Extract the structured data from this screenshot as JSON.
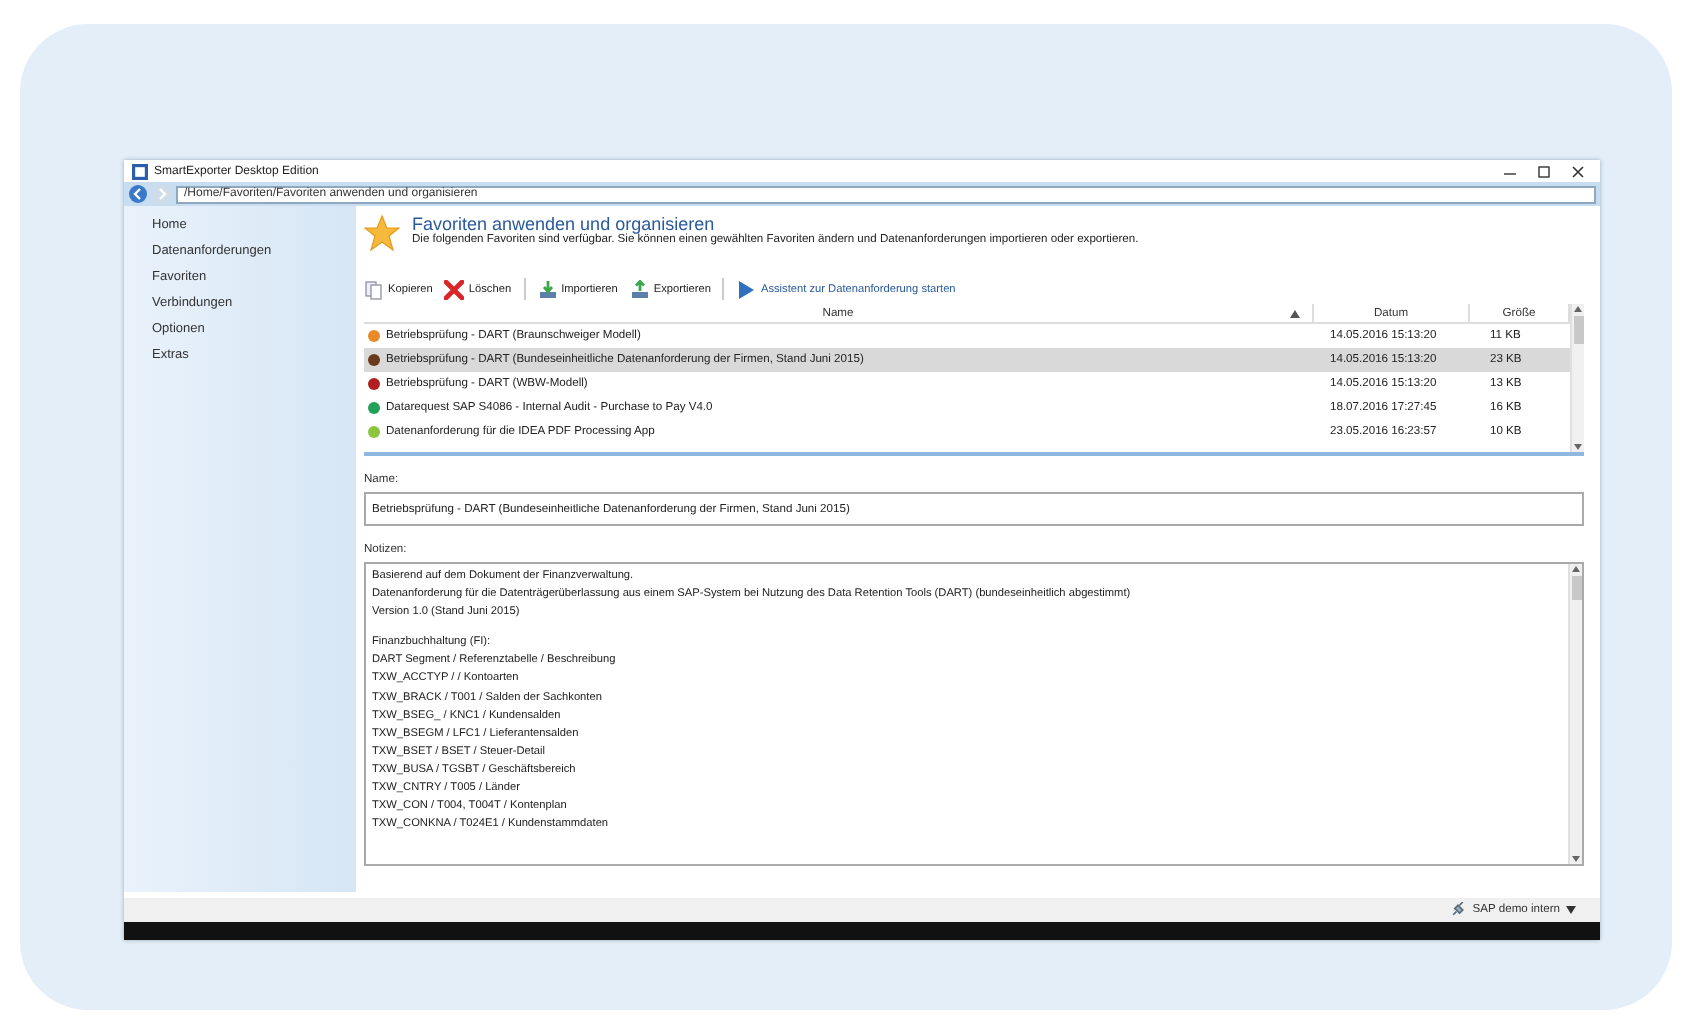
{
  "window": {
    "title": "SmartExporter Desktop Edition"
  },
  "address": {
    "path": "/Home/Favoriten/Favoriten anwenden und organisieren"
  },
  "sidebar": {
    "items": [
      {
        "label": "Home"
      },
      {
        "label": "Datenanforderungen"
      },
      {
        "label": "Favoriten"
      },
      {
        "label": "Verbindungen"
      },
      {
        "label": "Optionen"
      },
      {
        "label": "Extras"
      }
    ]
  },
  "header": {
    "title": "Favoriten anwenden und organisieren",
    "subtitle": "Die folgenden Favoriten sind verfügbar. Sie können einen gewählten Favoriten ändern und Datenanforderungen importieren oder exportieren."
  },
  "toolbar": {
    "buttons": [
      {
        "label": "Kopieren",
        "kind": "copy"
      },
      {
        "label": "Löschen",
        "kind": "delete"
      },
      {
        "label": "Importieren",
        "kind": "import"
      },
      {
        "label": "Exportieren",
        "kind": "export"
      },
      {
        "label": "Assistent zur Datenanforderung starten",
        "kind": "wizard"
      }
    ]
  },
  "table": {
    "columns": [
      "Name",
      "Datum",
      "Größe"
    ],
    "rows": [
      {
        "name": "Betriebsprüfung - DART (Braunschweiger Modell)",
        "date": "14.05.2016 15:13:20",
        "size": "11 KB",
        "color": "#e8892a",
        "selected": false
      },
      {
        "name": "Betriebsprüfung - DART (Bundeseinheitliche Datenanforderung der Firmen, Stand Juni 2015)",
        "date": "14.05.2016 15:13:20",
        "size": "23 KB",
        "color": "#6b3a1c",
        "selected": true
      },
      {
        "name": "Betriebsprüfung - DART (WBW-Modell)",
        "date": "14.05.2016 15:13:20",
        "size": "13 KB",
        "color": "#b0201e",
        "selected": false
      },
      {
        "name": "Datarequest SAP S4086 - Internal Audit - Purchase to Pay V4.0",
        "date": "18.07.2016 17:27:45",
        "size": "16 KB",
        "color": "#23a05a",
        "selected": false
      },
      {
        "name": "Datenanforderung für die IDEA PDF Processing App",
        "date": "23.05.2016 16:23:57",
        "size": "10 KB",
        "color": "#8cc63f",
        "selected": false
      }
    ]
  },
  "details": {
    "name_label": "Name:",
    "name_value": "Betriebsprüfung - DART (Bundeseinheitliche Datenanforderung der Firmen, Stand Juni 2015)",
    "notes_label": "Notizen:",
    "notes": [
      "Basierend auf dem Dokument der Finanzverwaltung.",
      "Datenanforderung für die Datenträgerüberlassung aus einem SAP-System bei Nutzung des Data Retention Tools (DART) (bundeseinheitlich abgestimmt)",
      "Version 1.0 (Stand Juni 2015)",
      "Finanzbuchhaltung (FI):",
      "DART Segment / Referenztabelle / Beschreibung",
      "TXW_ACCTYP / / Kontoarten",
      "TXW_BRACK / T001 / Salden der Sachkonten",
      "TXW_BSEG_ / KNC1 / Kundensalden",
      "TXW_BSEGM / LFC1 / Lieferantensalden",
      "TXW_BSET / BSET / Steuer-Detail",
      "TXW_BUSA / TGSBT / Geschäftsbereich",
      "TXW_CNTRY / T005 / Länder",
      "TXW_CON / T004, T004T / Kontenplan",
      "TXW_CONKNA / T024E1 / Kundenstammdaten"
    ]
  },
  "status_bar": {
    "connection": "SAP demo intern"
  }
}
